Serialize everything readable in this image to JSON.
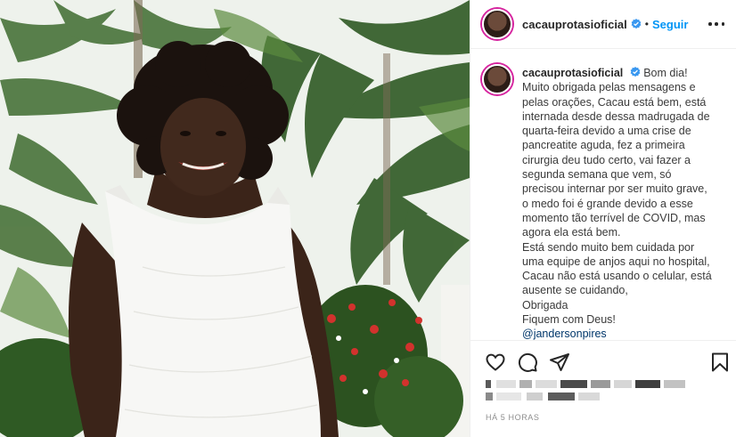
{
  "post": {
    "username": "cacauprotasioficial",
    "verified": true,
    "separator": "•",
    "follow_label": "Seguir",
    "caption": {
      "lines": [
        "Bom dia!",
        "Muito obrigada pelas mensagens e",
        "pelas orações, Cacau está bem, está",
        "internada desde dessa madrugada de",
        "quarta-feira devido a uma crise de",
        "pancreatite aguda, fez a primeira",
        "cirurgia deu tudo certo, vai fazer a",
        "segunda semana que vem, só",
        "precisou internar por ser muito grave,",
        "o medo foi é grande devido a esse",
        "momento tão terrível de COVID, mas",
        "agora ela está bem.",
        "Está sendo muito bem cuidada por",
        "uma equipe de anjos aqui no hospital,",
        "Cacau não está usando o celular, está",
        "ausente se cuidando,",
        "Obrigada",
        "Fiquem com Deus!"
      ],
      "mention": "@jandersonpires"
    },
    "timestamp": "HÁ 5 HORAS",
    "icons": [
      "heart-icon",
      "comment-icon",
      "share-icon",
      "bookmark-icon",
      "more-options-icon",
      "verified-badge-icon"
    ]
  },
  "colors": {
    "link": "#0095f6",
    "mention": "#00376b",
    "text": "#262626",
    "muted": "#8e8e8e",
    "border": "#efefef"
  }
}
